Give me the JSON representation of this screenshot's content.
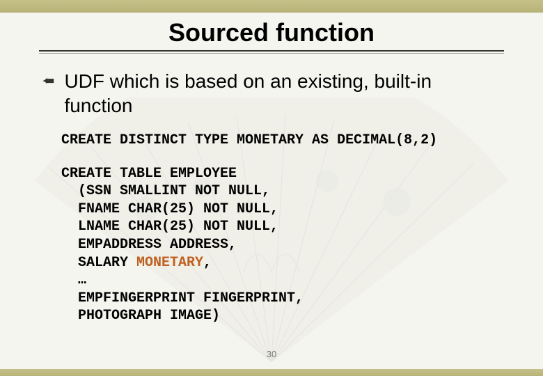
{
  "slide": {
    "title": "Sourced function",
    "bullet": "UDF which is based on an existing, built-in function",
    "code1": "CREATE DISTINCT TYPE MONETARY AS DECIMAL(8,2)",
    "code2_lines": [
      "CREATE TABLE EMPLOYEE",
      "  (SSN SMALLINT NOT NULL,",
      "  FNAME CHAR(25) NOT NULL,",
      "  LNAME CHAR(25) NOT NULL,",
      "  EMPADDRESS ADDRESS,",
      "  SALARY ",
      ",",
      "  …",
      "  EMPFINGERPRINT FINGERPRINT,",
      "  PHOTOGRAPH IMAGE)"
    ],
    "code2_highlight": "MONETARY",
    "page_number": "30"
  },
  "colors": {
    "bar": "#c4c088",
    "highlight": "#c06020"
  }
}
